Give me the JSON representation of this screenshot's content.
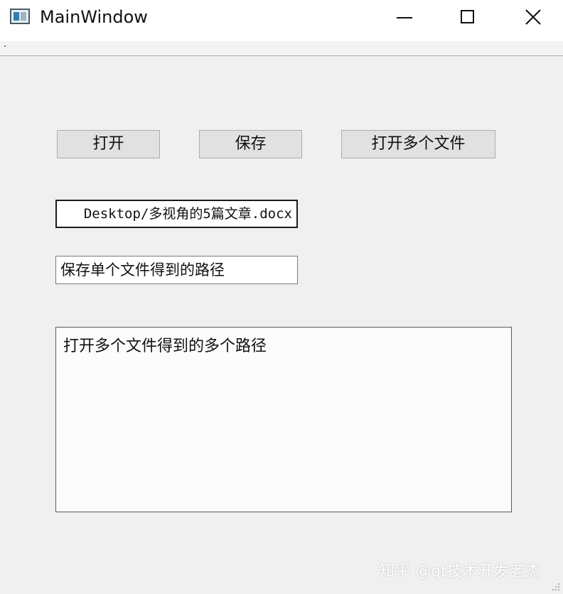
{
  "window": {
    "title": "MainWindow"
  },
  "toolbar": {
    "open_label": "打开",
    "save_label": "保存",
    "open_multiple_label": "打开多个文件"
  },
  "fields": {
    "selected_path_value": "Desktop/多视角的5篇文章.docx",
    "save_path_value": "保存单个文件得到的路径",
    "multi_paths_value": "打开多个文件得到的多个路径"
  },
  "watermark": {
    "text": "知乎 @qt技术开发老杰"
  },
  "icons": {
    "app": "app-window-icon",
    "minimize": "minimize-icon",
    "maximize": "maximize-icon",
    "close": "close-icon"
  }
}
